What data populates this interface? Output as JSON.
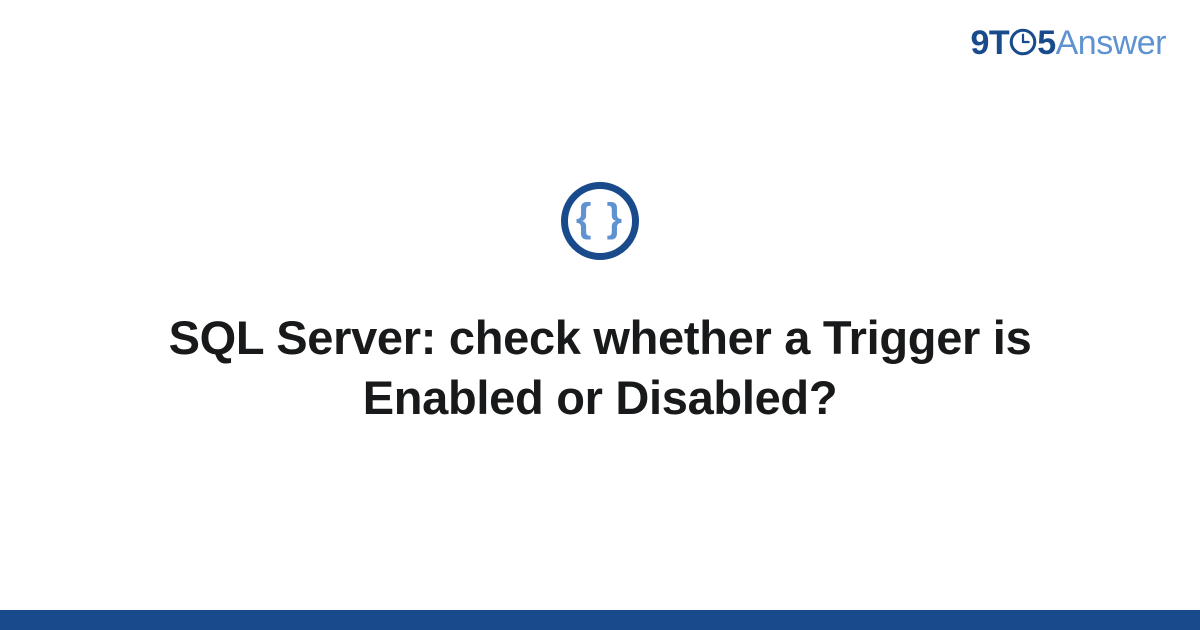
{
  "brand": {
    "part1": "9T",
    "part2": "5",
    "part3": "Answer"
  },
  "icon": {
    "name": "curly-braces-icon",
    "glyph": "{ }"
  },
  "title": "SQL Server: check whether a Trigger is Enabled or Disabled?",
  "colors": {
    "primary": "#194b8c",
    "accent": "#5f92d0"
  }
}
